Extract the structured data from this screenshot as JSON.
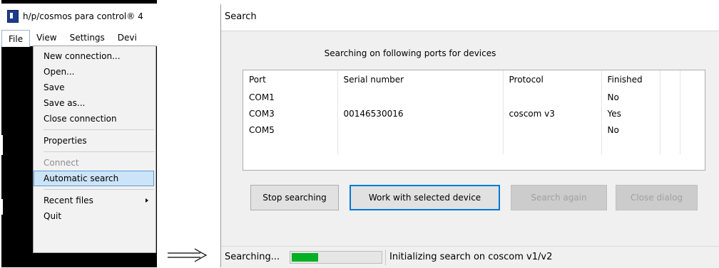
{
  "app": {
    "title": "h/p/cosmos para control® 4",
    "menubar": [
      "File",
      "View",
      "Settings",
      "Devi"
    ],
    "file_menu": {
      "items": [
        {
          "label": "New connection...",
          "state": "normal"
        },
        {
          "label": "Open...",
          "state": "normal"
        },
        {
          "label": "Save",
          "state": "normal"
        },
        {
          "label": "Save as...",
          "state": "normal"
        },
        {
          "label": "Close connection",
          "state": "normal"
        },
        {
          "separator": true
        },
        {
          "label": "Properties",
          "state": "normal"
        },
        {
          "separator": true
        },
        {
          "label": "Connect",
          "state": "disabled"
        },
        {
          "label": "Automatic search",
          "state": "highlighted"
        },
        {
          "separator": true
        },
        {
          "label": "Recent files",
          "state": "submenu"
        },
        {
          "label": "Quit",
          "state": "normal"
        }
      ]
    }
  },
  "dialog": {
    "title": "Search",
    "caption": "Searching on following ports for devices",
    "columns": [
      "Port",
      "Serial number",
      "Protocol",
      "Finished"
    ],
    "rows": [
      {
        "port": "COM1",
        "serial": "",
        "protocol": "",
        "finished": "No"
      },
      {
        "port": "COM3",
        "serial": "00146530016",
        "protocol": "coscom v3",
        "finished": "Yes"
      },
      {
        "port": "COM5",
        "serial": "",
        "protocol": "",
        "finished": "No"
      }
    ],
    "buttons": {
      "stop": "Stop searching",
      "work": "Work with selected device",
      "again": "Search again",
      "close": "Close dialog"
    },
    "status": {
      "text": "Searching...",
      "progress": 0.3,
      "message": "Initializing search on coscom v1/v2"
    }
  },
  "colors": {
    "highlight": "#cce4f7",
    "highlight_border": "#5d9bd6",
    "progress_fill": "#06b025",
    "primary_border": "#0078d7"
  }
}
